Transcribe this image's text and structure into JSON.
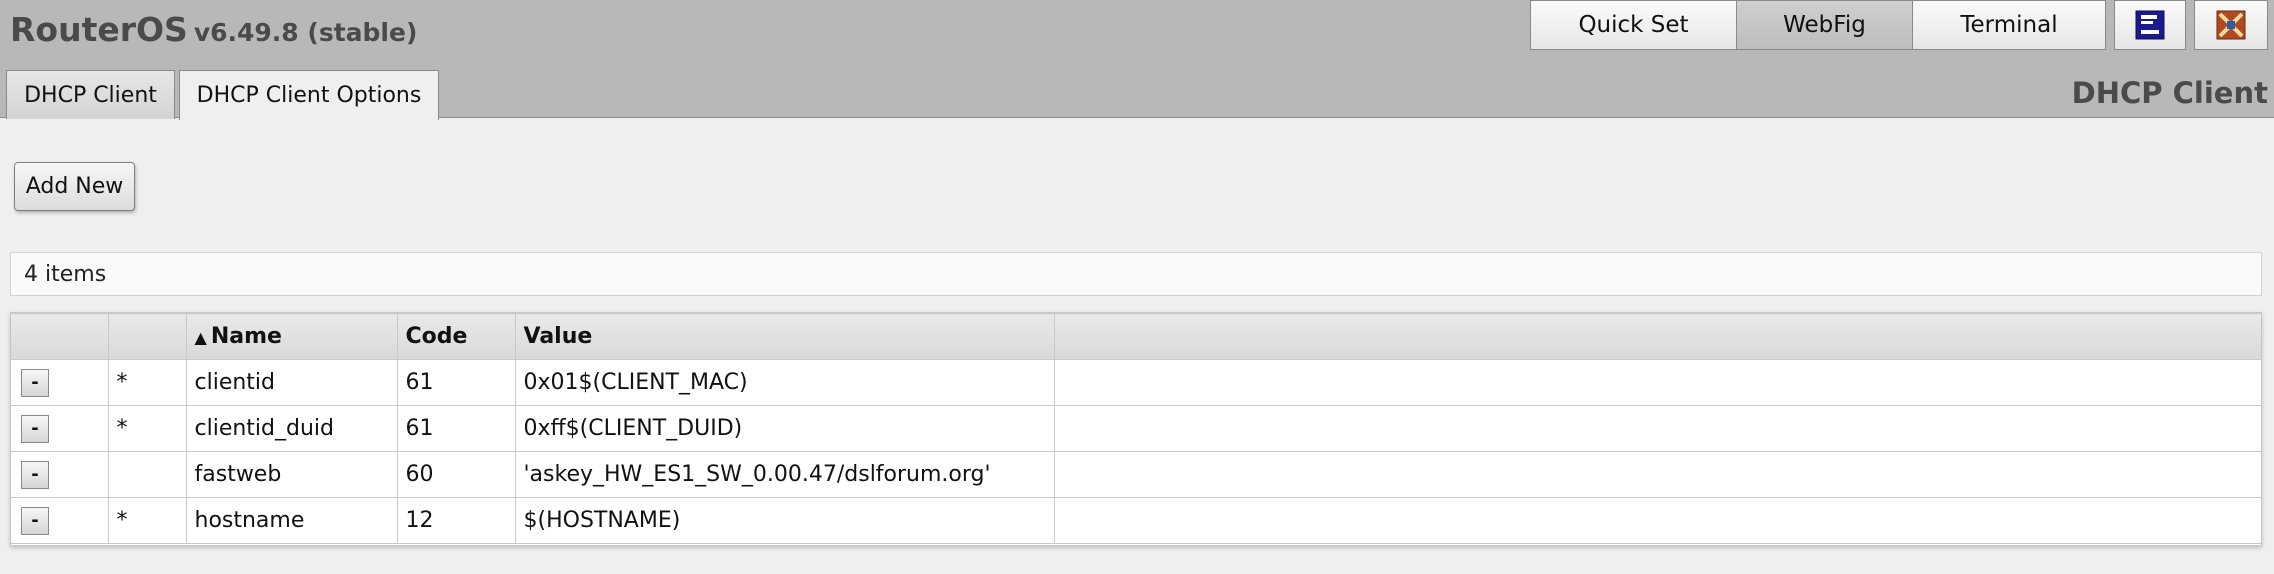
{
  "header": {
    "brand": "RouterOS",
    "version": "v6.49.8 (stable)",
    "buttons": [
      {
        "label": "Quick Set",
        "active": false
      },
      {
        "label": "WebFig",
        "active": true
      },
      {
        "label": "Terminal",
        "active": false
      }
    ],
    "icons": [
      "winbox-icon",
      "flag-icon"
    ]
  },
  "tabs": [
    {
      "label": "DHCP Client",
      "active": false
    },
    {
      "label": "DHCP Client Options",
      "active": true
    }
  ],
  "section_title": "DHCP Client",
  "toolbar": {
    "add_new_label": "Add New"
  },
  "item_count": "4 items",
  "table": {
    "columns": [
      "",
      "",
      "Name",
      "Code",
      "Value",
      ""
    ],
    "sorted_column": "Name",
    "sort_direction": "ascending",
    "rows": [
      {
        "remove": "-",
        "flag": "*",
        "name": "clientid",
        "code": "61",
        "value": "0x01$(CLIENT_MAC)"
      },
      {
        "remove": "-",
        "flag": "*",
        "name": "clientid_duid",
        "code": "61",
        "value": "0xff$(CLIENT_DUID)"
      },
      {
        "remove": "-",
        "flag": "",
        "name": "fastweb",
        "code": "60",
        "value": "'askey_HW_ES1_SW_0.00.47/dslforum.org'"
      },
      {
        "remove": "-",
        "flag": "*",
        "name": "hostname",
        "code": "12",
        "value": "$(HOSTNAME)"
      }
    ]
  },
  "colors": {
    "topbar": "#b8b8b8",
    "background": "#efefef",
    "brand_text": "#4a4a4a"
  }
}
